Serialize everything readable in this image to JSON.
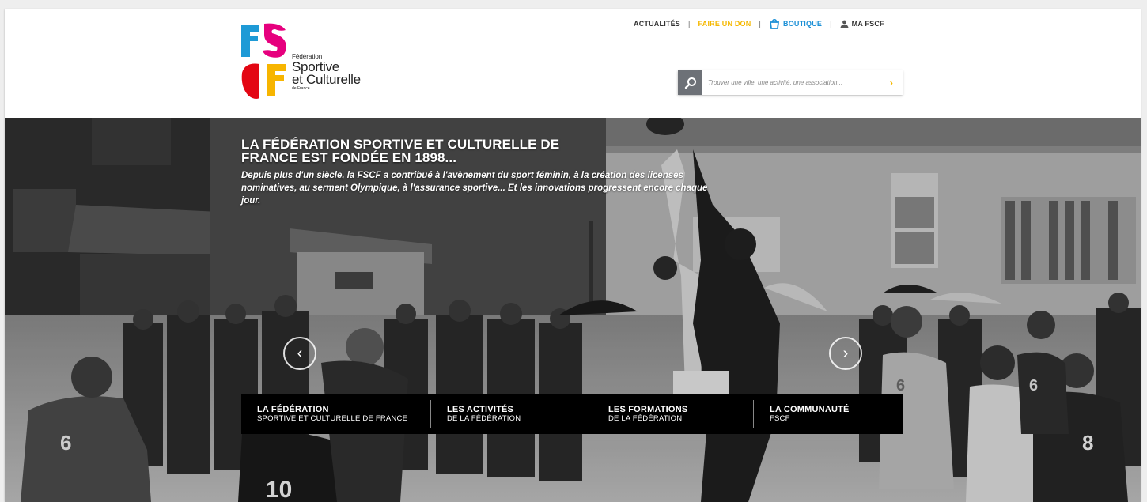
{
  "header": {
    "logo": {
      "line1": "Fédération",
      "line2": "Sportive",
      "line3": "et Culturelle",
      "line4": "de France",
      "colors": [
        "#1e9ad6",
        "#e6007e",
        "#e30613",
        "#f7b500"
      ]
    },
    "topnav": {
      "actualites": "ACTUALITÉS",
      "don": "FAIRE UN DON",
      "boutique": "BOUTIQUE",
      "ma_fscf": "MA FSCF"
    },
    "search": {
      "placeholder": "Trouver une ville, une activité, une association..."
    }
  },
  "hero": {
    "title": "LA FÉDÉRATION SPORTIVE ET CULTURELLE DE FRANCE EST FONDÉE EN 1898...",
    "description": "Depuis plus d'un siècle, la FSCF a contribué à l'avènement du sport féminin, à la création des licenses nominatives, au serment Olympique, à l'assurance sportive... Et les innovations progressent encore chaque jour.",
    "prev_icon": "chevron-left-icon",
    "next_icon": "chevron-right-icon",
    "menu": [
      {
        "line1": "LA FÉDÉRATION",
        "line2": "SPORTIVE ET CULTURELLE DE FRANCE"
      },
      {
        "line1": "LES ACTIVITÉS",
        "line2": "DE LA FÉDÉRATION"
      },
      {
        "line1": "LES FORMATIONS",
        "line2": "DE LA FÉDÉRATION"
      },
      {
        "line1": "LA COMMUNAUTÉ",
        "line2": "FSCF"
      }
    ],
    "jersey_numbers": [
      "6",
      "10",
      "6",
      "6",
      "8"
    ]
  },
  "colors": {
    "accent_yellow": "#f5b800",
    "accent_blue": "#1a8fd6",
    "menu_bg": "#000000"
  }
}
